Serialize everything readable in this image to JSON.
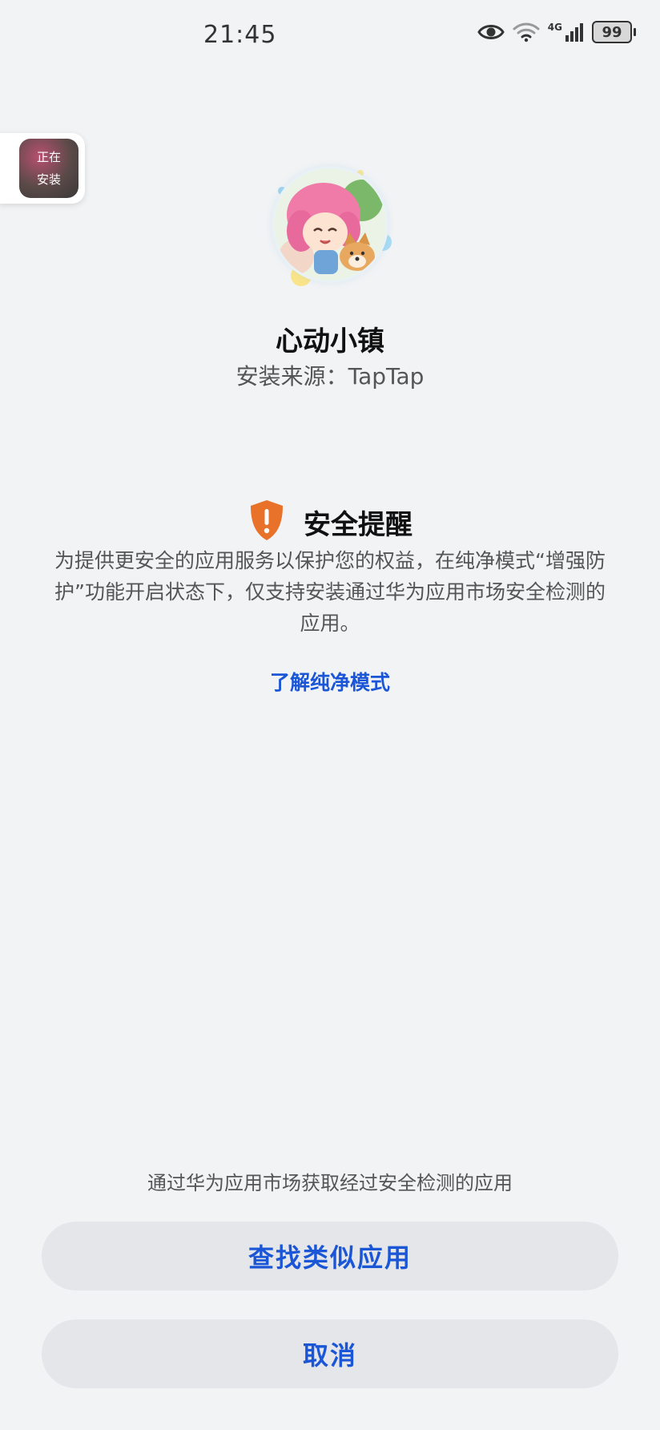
{
  "status_bar": {
    "time": "21:45",
    "network": "4G",
    "battery": "99"
  },
  "installing_badge": {
    "line1": "正在",
    "line2": "安装"
  },
  "app": {
    "name": "心动小镇",
    "source": "安装来源：TapTap"
  },
  "security": {
    "title": "安全提醒",
    "description": "为提供更安全的应用服务以保护您的权益，在纯净模式“增强防护”功能开启状态下，仅支持安装通过华为应用市场安全检测的应用。",
    "learn_more": "了解纯净模式",
    "accent_color": "#e8722a"
  },
  "bottom": {
    "hint": "通过华为应用市场获取经过安全检测的应用",
    "find_similar_label": "查找类似应用",
    "cancel_label": "取消"
  },
  "colors": {
    "background": "#f1f3f5",
    "link": "#1a56d6",
    "button_bg": "#e4e6e9"
  }
}
